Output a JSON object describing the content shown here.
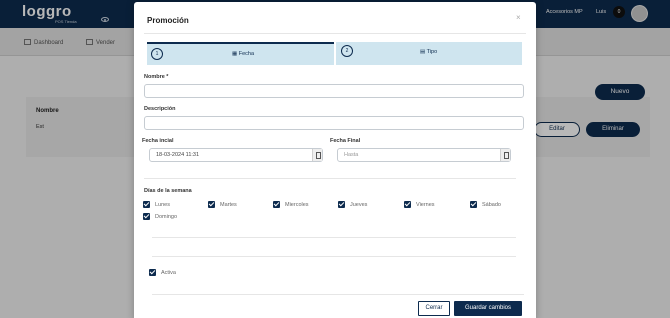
{
  "app": {
    "logo_text": "loggro",
    "logo_sub": "POS Tienda",
    "account_label": "Accesorios MP",
    "user_label": "Luis",
    "notif_count": "0"
  },
  "nav": {
    "dashboard": "Dashboard",
    "vender": "Vender"
  },
  "table": {
    "column_nombre": "Nombre",
    "row_name": "Est",
    "nuevo_button": "Nuevo",
    "editar_button": "Editar",
    "eliminar_button": "Eliminar"
  },
  "modal": {
    "title": "Promoción",
    "close_glyph": "×",
    "steps": [
      {
        "number": "1",
        "label": "Fecha"
      },
      {
        "number": "2",
        "label": "Tipo"
      }
    ],
    "nombre_label": "Nombre *",
    "nombre_value": "",
    "descripcion_label": "Descripción",
    "descripcion_value": "",
    "fecha_inicial_label": "Fecha incial",
    "fecha_inicial_value": "18-03-2024 11:31",
    "fecha_final_label": "Fecha Final",
    "fecha_final_placeholder": "Hasta",
    "dias_label": "Días de la semana",
    "dias": [
      {
        "label": "Lunes",
        "checked": true
      },
      {
        "label": "Martes",
        "checked": true
      },
      {
        "label": "Miercoles",
        "checked": true
      },
      {
        "label": "Jueves",
        "checked": true
      },
      {
        "label": "Viernes",
        "checked": true
      },
      {
        "label": "Sábado",
        "checked": true
      },
      {
        "label": "Domingo",
        "checked": true
      }
    ],
    "activa_label": "Activa",
    "activa_checked": true,
    "cerrar_button": "Cerrar",
    "guardar_button": "Guardar cambios"
  },
  "colors": {
    "primary": "#0d2b4e",
    "step_bg": "#cfe5ef"
  }
}
